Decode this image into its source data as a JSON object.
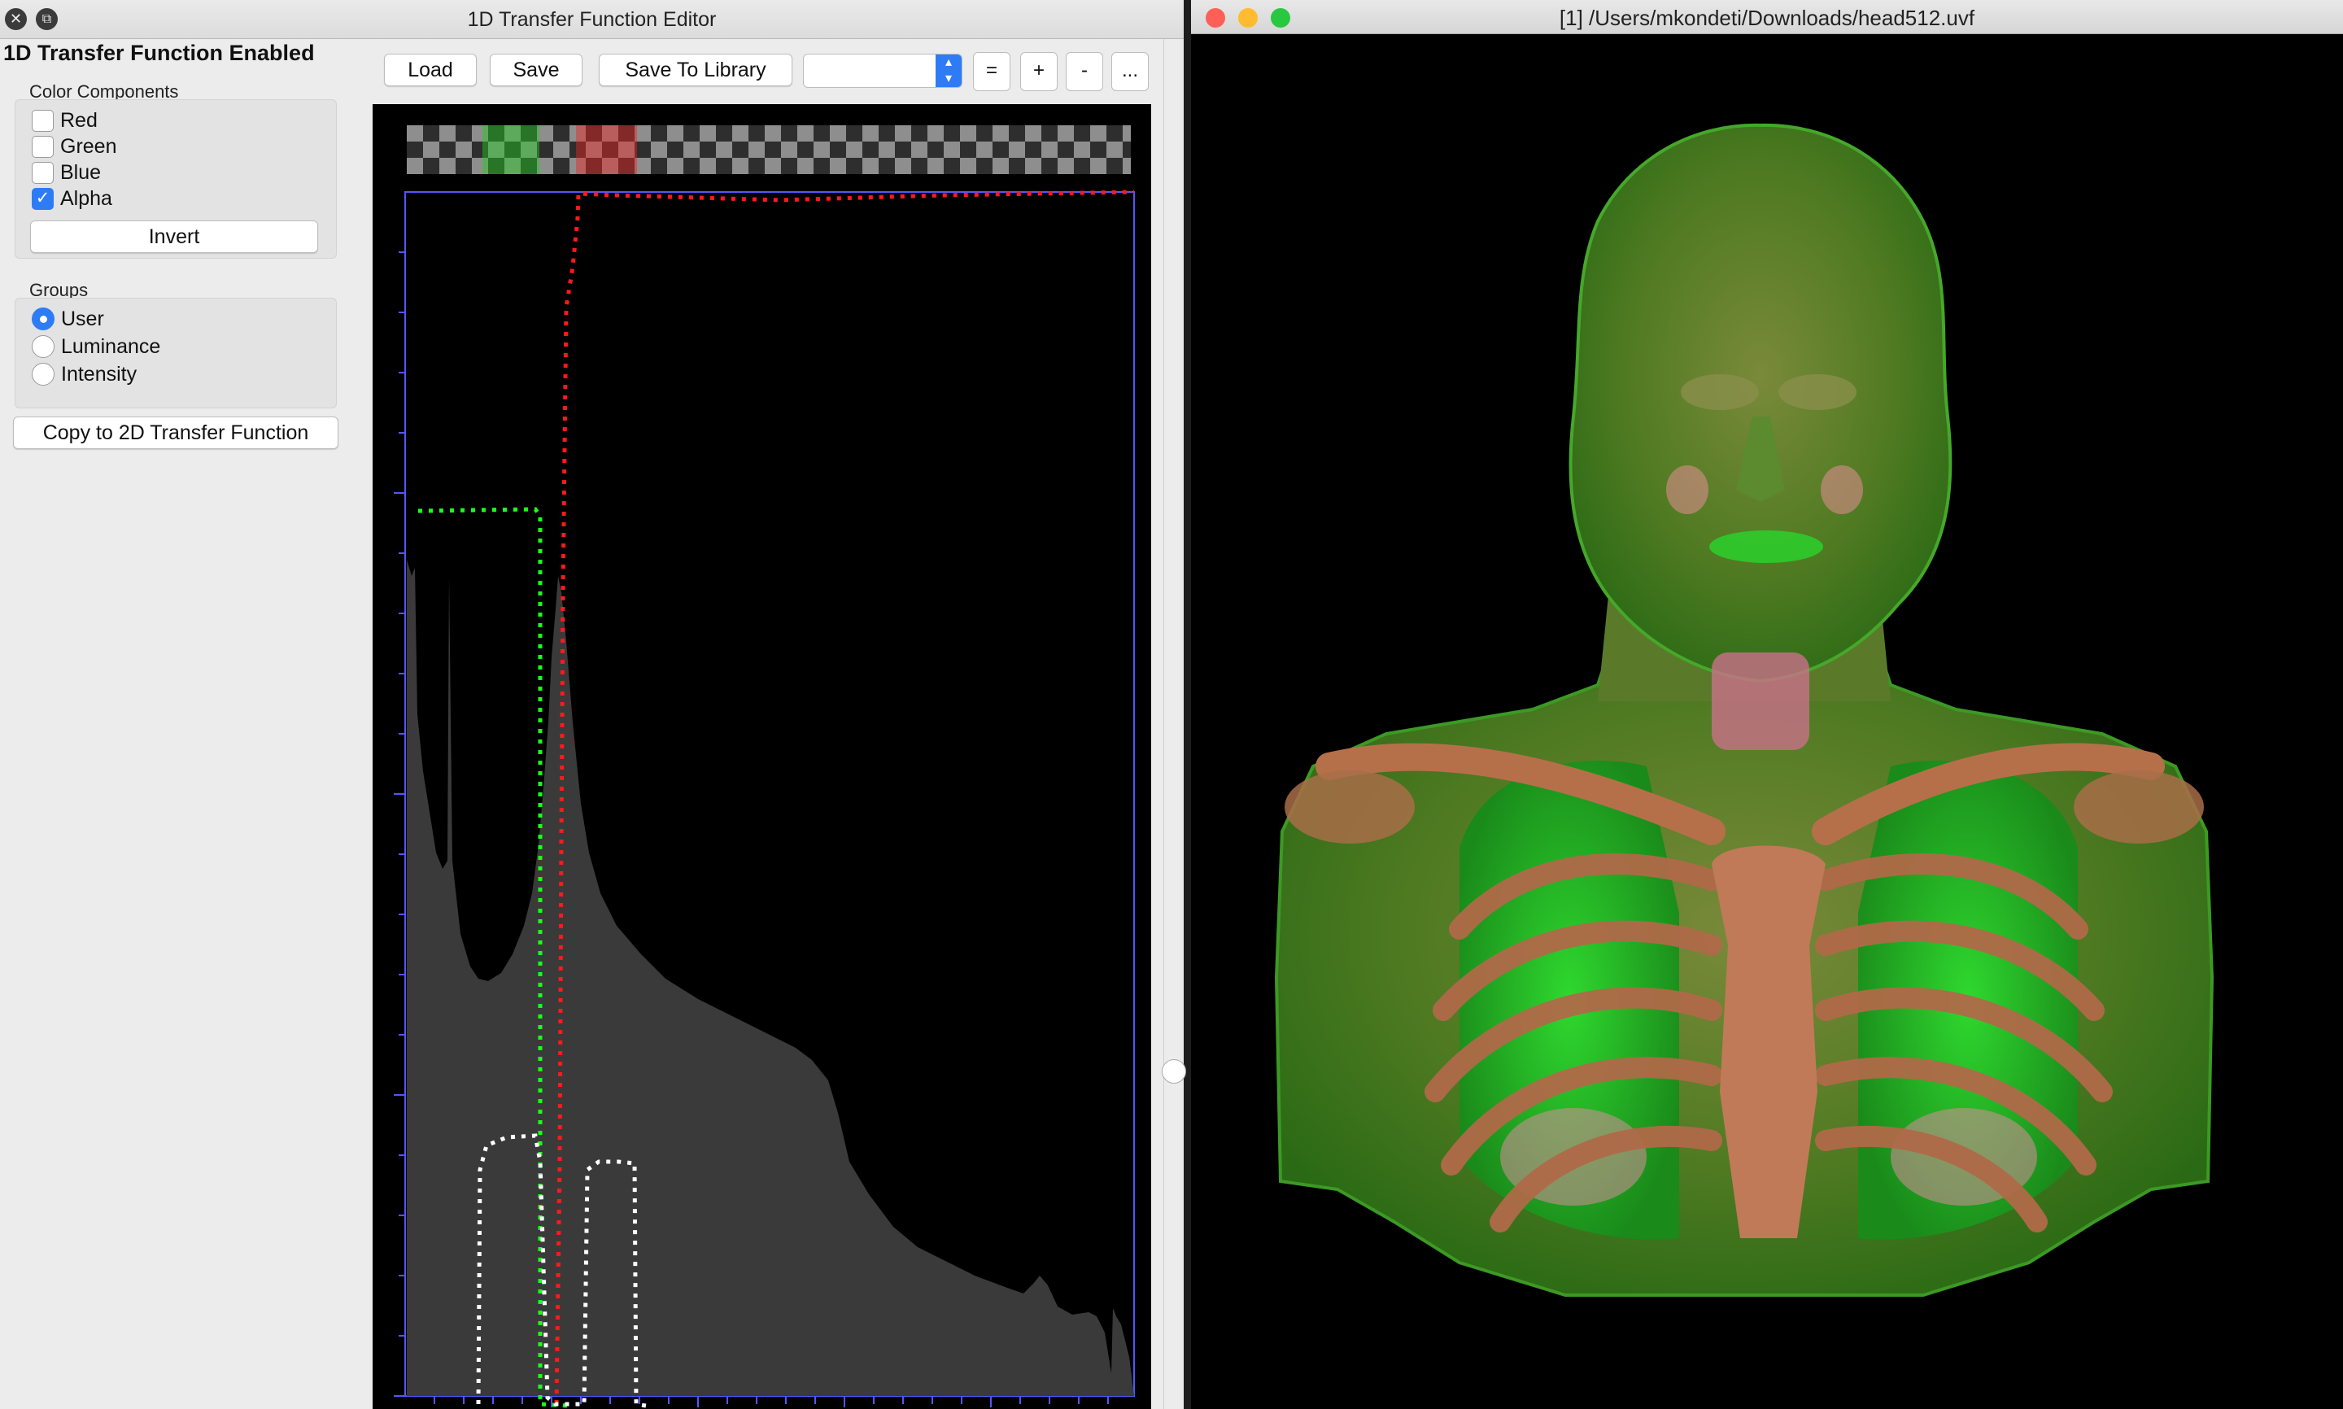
{
  "editor": {
    "title": "1D Transfer Function Editor",
    "close_glyph": "✕",
    "float_glyph": "⧉",
    "enabled_label": "1D Transfer Function Enabled",
    "color_components": {
      "caption": "Color Components",
      "items": [
        {
          "label": "Red",
          "checked": false
        },
        {
          "label": "Green",
          "checked": false
        },
        {
          "label": "Blue",
          "checked": false
        },
        {
          "label": "Alpha",
          "checked": true
        }
      ],
      "invert_label": "Invert"
    },
    "groups": {
      "caption": "Groups",
      "items": [
        {
          "label": "User",
          "selected": true
        },
        {
          "label": "Luminance",
          "selected": false
        },
        {
          "label": "Intensity",
          "selected": false
        }
      ]
    },
    "copy_2d_label": "Copy to 2D Transfer Function",
    "toolbar": {
      "load_label": "Load",
      "save_label": "Save",
      "save_library_label": "Save To Library",
      "preset_value": "",
      "equals_label": "=",
      "plus_label": "+",
      "minus_label": "-",
      "more_label": "..."
    },
    "colors": {
      "red_curve": "#ff1a1a",
      "green_curve": "#1aff1a",
      "alpha_curve": "#ffffff",
      "histogram": "#3a3a3a",
      "frame": "#5555ff",
      "accent": "#2d7cf6"
    }
  },
  "render": {
    "title": "[1] /Users/mkondeti/Downloads/head512.uvf",
    "traffic_colors": [
      "#fe5f57",
      "#febc2e",
      "#28c840"
    ]
  }
}
